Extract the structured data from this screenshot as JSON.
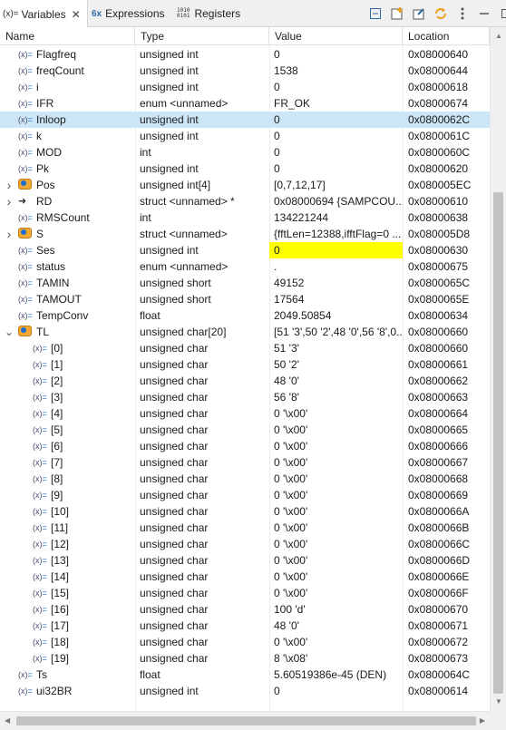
{
  "tabs": {
    "variables_icon": "(x)=",
    "variables_label": "Variables",
    "expressions_label": "Expressions",
    "registers_label": "Registers"
  },
  "toolbar": {
    "icons": [
      "collapse-all-icon",
      "new-watch-icon",
      "edit-layout-icon",
      "refresh-icon",
      "view-menu-icon",
      "minimize-icon",
      "maximize-icon"
    ]
  },
  "columns": {
    "name": "Name",
    "type": "Type",
    "value": "Value",
    "location": "Location"
  },
  "rows": [
    {
      "name": "Flagfreq",
      "type": "unsigned int",
      "value": "0",
      "location": "0x08000640",
      "level": 0,
      "icon": "variable"
    },
    {
      "name": "freqCount",
      "type": "unsigned int",
      "value": "1538",
      "location": "0x08000644",
      "level": 0,
      "icon": "variable"
    },
    {
      "name": "i",
      "type": "unsigned int",
      "value": "0",
      "location": "0x08000618",
      "level": 0,
      "icon": "variable"
    },
    {
      "name": "IFR",
      "type": "enum <unnamed>",
      "value": "FR_OK",
      "location": "0x08000674",
      "level": 0,
      "icon": "variable"
    },
    {
      "name": "Inloop",
      "type": "unsigned int",
      "value": "0",
      "location": "0x0800062C",
      "level": 0,
      "icon": "variable",
      "selected": true
    },
    {
      "name": "k",
      "type": "unsigned int",
      "value": "0",
      "location": "0x0800061C",
      "level": 0,
      "icon": "variable"
    },
    {
      "name": "MOD",
      "type": "int",
      "value": "0",
      "location": "0x0800060C",
      "level": 0,
      "icon": "variable"
    },
    {
      "name": "Pk",
      "type": "unsigned int",
      "value": "0",
      "location": "0x08000620",
      "level": 0,
      "icon": "variable"
    },
    {
      "name": "Pos",
      "type": "unsigned int[4]",
      "value": "[0,7,12,17]",
      "location": "0x080005EC",
      "level": 0,
      "icon": "struct",
      "expandable": "collapsed"
    },
    {
      "name": "RD",
      "type": "struct <unnamed> *",
      "value": "0x08000694 {SAMPCOU...",
      "location": "0x08000610",
      "level": 0,
      "icon": "pointer",
      "expandable": "collapsed"
    },
    {
      "name": "RMSCount",
      "type": "int",
      "value": "134221244",
      "location": "0x08000638",
      "level": 0,
      "icon": "variable"
    },
    {
      "name": "S",
      "type": "struct <unnamed>",
      "value": "{fftLen=12388,ifftFlag=0 ...",
      "location": "0x080005D8",
      "level": 0,
      "icon": "struct",
      "expandable": "collapsed"
    },
    {
      "name": "Ses",
      "type": "unsigned int",
      "value": "0",
      "location": "0x08000630",
      "level": 0,
      "icon": "variable",
      "highlight": true
    },
    {
      "name": "status",
      "type": "enum <unnamed>",
      "value": ".",
      "location": "0x08000675",
      "level": 0,
      "icon": "variable"
    },
    {
      "name": "TAMIN",
      "type": "unsigned short",
      "value": "49152",
      "location": "0x0800065C",
      "level": 0,
      "icon": "variable"
    },
    {
      "name": "TAMOUT",
      "type": "unsigned short",
      "value": "17564",
      "location": "0x0800065E",
      "level": 0,
      "icon": "variable"
    },
    {
      "name": "TempConv",
      "type": "float",
      "value": "2049.50854",
      "location": "0x08000634",
      "level": 0,
      "icon": "variable"
    },
    {
      "name": "TL",
      "type": "unsigned char[20]",
      "value": "[51 '3',50 '2',48 '0',56 '8',0...",
      "location": "0x08000660",
      "level": 0,
      "icon": "struct",
      "expandable": "expanded"
    },
    {
      "name": "[0]",
      "type": "unsigned char",
      "value": "51 '3'",
      "location": "0x08000660",
      "level": 1,
      "icon": "variable"
    },
    {
      "name": "[1]",
      "type": "unsigned char",
      "value": "50 '2'",
      "location": "0x08000661",
      "level": 1,
      "icon": "variable"
    },
    {
      "name": "[2]",
      "type": "unsigned char",
      "value": "48 '0'",
      "location": "0x08000662",
      "level": 1,
      "icon": "variable"
    },
    {
      "name": "[3]",
      "type": "unsigned char",
      "value": "56 '8'",
      "location": "0x08000663",
      "level": 1,
      "icon": "variable"
    },
    {
      "name": "[4]",
      "type": "unsigned char",
      "value": "0 '\\x00'",
      "location": "0x08000664",
      "level": 1,
      "icon": "variable"
    },
    {
      "name": "[5]",
      "type": "unsigned char",
      "value": "0 '\\x00'",
      "location": "0x08000665",
      "level": 1,
      "icon": "variable"
    },
    {
      "name": "[6]",
      "type": "unsigned char",
      "value": "0 '\\x00'",
      "location": "0x08000666",
      "level": 1,
      "icon": "variable"
    },
    {
      "name": "[7]",
      "type": "unsigned char",
      "value": "0 '\\x00'",
      "location": "0x08000667",
      "level": 1,
      "icon": "variable"
    },
    {
      "name": "[8]",
      "type": "unsigned char",
      "value": "0 '\\x00'",
      "location": "0x08000668",
      "level": 1,
      "icon": "variable"
    },
    {
      "name": "[9]",
      "type": "unsigned char",
      "value": "0 '\\x00'",
      "location": "0x08000669",
      "level": 1,
      "icon": "variable"
    },
    {
      "name": "[10]",
      "type": "unsigned char",
      "value": "0 '\\x00'",
      "location": "0x0800066A",
      "level": 1,
      "icon": "variable"
    },
    {
      "name": "[11]",
      "type": "unsigned char",
      "value": "0 '\\x00'",
      "location": "0x0800066B",
      "level": 1,
      "icon": "variable"
    },
    {
      "name": "[12]",
      "type": "unsigned char",
      "value": "0 '\\x00'",
      "location": "0x0800066C",
      "level": 1,
      "icon": "variable"
    },
    {
      "name": "[13]",
      "type": "unsigned char",
      "value": "0 '\\x00'",
      "location": "0x0800066D",
      "level": 1,
      "icon": "variable"
    },
    {
      "name": "[14]",
      "type": "unsigned char",
      "value": "0 '\\x00'",
      "location": "0x0800066E",
      "level": 1,
      "icon": "variable"
    },
    {
      "name": "[15]",
      "type": "unsigned char",
      "value": "0 '\\x00'",
      "location": "0x0800066F",
      "level": 1,
      "icon": "variable"
    },
    {
      "name": "[16]",
      "type": "unsigned char",
      "value": "100 'd'",
      "location": "0x08000670",
      "level": 1,
      "icon": "variable"
    },
    {
      "name": "[17]",
      "type": "unsigned char",
      "value": "48 '0'",
      "location": "0x08000671",
      "level": 1,
      "icon": "variable"
    },
    {
      "name": "[18]",
      "type": "unsigned char",
      "value": "0 '\\x00'",
      "location": "0x08000672",
      "level": 1,
      "icon": "variable"
    },
    {
      "name": "[19]",
      "type": "unsigned char",
      "value": "8 '\\x08'",
      "location": "0x08000673",
      "level": 1,
      "icon": "variable"
    },
    {
      "name": "Ts",
      "type": "float",
      "value": "5.60519386e-45 (DEN)",
      "location": "0x0800064C",
      "level": 0,
      "icon": "variable"
    },
    {
      "name": "ui32BR",
      "type": "unsigned int",
      "value": "0",
      "location": "0x08000614",
      "level": 0,
      "icon": "variable"
    }
  ],
  "colors": {
    "selected_row": "#cce5f7",
    "highlight_value": "#ffff00",
    "struct_icon": "#f0a830"
  }
}
